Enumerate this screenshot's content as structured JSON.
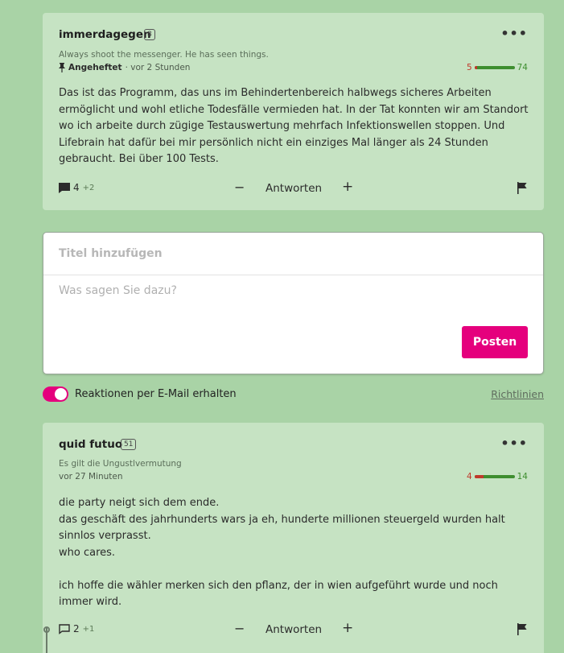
{
  "comments": [
    {
      "username": "immerdagegen",
      "badge": "8",
      "tagline": "Always shoot the messenger. He has seen things.",
      "pinned_label": "Angeheftet",
      "time": "· vor 2 Stunden",
      "votes_negative": "5",
      "votes_positive": "74",
      "negative_fraction": 0.063,
      "body": "Das ist das Programm, das uns im Behindertenbereich halbwegs sicheres Arbeiten ermöglicht und wohl etliche Todesfälle vermieden hat. In der Tat konnten wir am Standort wo ich arbeite durch zügige Testauswertung mehrfach Infektionswellen stoppen. Und Lifebrain hat dafür bei mir persönlich nicht ein einziges Mal länger als 24 Stunden gebraucht. Bei über 100 Tests.",
      "reply_count": "4",
      "reply_new": "+2",
      "minus_label": "−",
      "answer_label": "Antworten",
      "plus_label": "+"
    },
    {
      "username": "quid futuo",
      "badge": "51",
      "tagline": "Es gilt die Ungustlvermutung",
      "time": "vor 27 Minuten",
      "votes_negative": "4",
      "votes_positive": "14",
      "negative_fraction": 0.222,
      "body": "die party neigt sich dem ende.\ndas geschäft des jahrhunderts wars ja eh, hunderte millionen steuergeld wurden halt sinnlos verprasst.\nwho cares.\n\nich hoffe die wähler merken sich den pflanz, der in wien aufgeführt wurde und noch immer wird.",
      "reply_count": "2",
      "reply_new": "+1",
      "minus_label": "−",
      "answer_label": "Antworten",
      "plus_label": "+"
    }
  ],
  "composer": {
    "title_placeholder": "Titel hinzufügen",
    "body_placeholder": "Was sagen Sie dazu?",
    "post_label": "Posten"
  },
  "email_toggle": {
    "label": "Reaktionen per E-Mail erhalten",
    "enabled": true
  },
  "guidelines_label": "Richtlinien",
  "colors": {
    "background": "#a9d3a6",
    "card": "#c6e3c3",
    "accent": "#e5007d",
    "vote_negative": "#c0392b",
    "vote_positive": "#3e8e2f"
  },
  "icons": {
    "more": "more-dots-icon",
    "pin": "pin-icon",
    "replies": "speech-bubble-icon",
    "flag": "flag-icon"
  }
}
